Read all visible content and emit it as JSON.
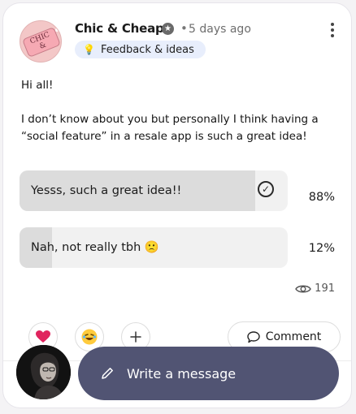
{
  "post": {
    "author": "Chic & Cheap",
    "author_badge_icon": "verified-star-icon",
    "separator": "•",
    "time": "5 days ago",
    "category": "Feedback & ideas",
    "category_icon": "lightbulb-icon",
    "text": [
      "Hi all!",
      "I don’t know about you but personally I think having a “social feature” in a resale app is such a great idea!"
    ]
  },
  "poll": {
    "options": [
      {
        "label": "Yesss, such a great idea!!",
        "percent_label": "88%",
        "fraction": 0.88,
        "selected": true
      },
      {
        "label": "Nah, not really tbh 🙁",
        "percent_label": "12%",
        "fraction": 0.12,
        "selected": false
      }
    ]
  },
  "stats": {
    "views": "191",
    "views_icon": "eye-icon"
  },
  "actions": {
    "reactions": [
      "heart-reaction-icon",
      "laughing-emoji-reaction-icon",
      "add-reaction-plus-icon"
    ],
    "comment_label": "Comment"
  },
  "composer": {
    "placeholder": "Write a message",
    "icon": "pencil-icon"
  },
  "colors": {
    "composer_bg": "#515473",
    "heart": "#e0245e",
    "category_bg": "#e8eefc"
  }
}
